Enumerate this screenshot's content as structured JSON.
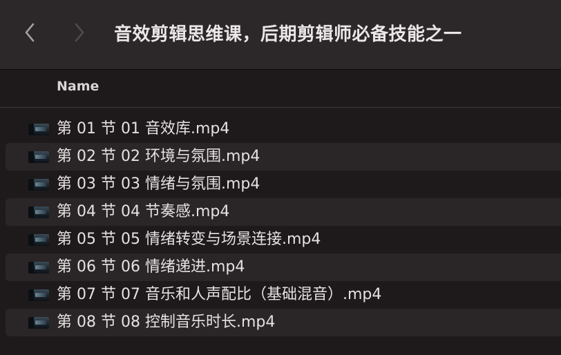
{
  "window": {
    "title": "音效剪辑思维课，后期剪辑师必备技能之一"
  },
  "toolbar": {
    "back_icon": "chevron-left-icon",
    "forward_icon": "chevron-right-icon"
  },
  "columns": {
    "name": "Name"
  },
  "files": [
    {
      "name": "第 01 节 01 音效库.mp4",
      "icon": "video-thumbnail-icon"
    },
    {
      "name": "第 02 节 02 环境与氛围.mp4",
      "icon": "video-thumbnail-icon"
    },
    {
      "name": "第 03 节 03 情绪与氛围.mp4",
      "icon": "video-thumbnail-icon"
    },
    {
      "name": "第 04 节 04 节奏感.mp4",
      "icon": "video-thumbnail-icon"
    },
    {
      "name": "第 05 节 05 情绪转变与场景连接.mp4",
      "icon": "video-thumbnail-icon"
    },
    {
      "name": "第 06 节 06 情绪递进.mp4",
      "icon": "video-thumbnail-icon"
    },
    {
      "name": "第 07 节 07 音乐和人声配比（基础混音）.mp4",
      "icon": "video-thumbnail-icon"
    },
    {
      "name": "第 08 节 08 控制音乐时长.mp4",
      "icon": "video-thumbnail-icon"
    }
  ],
  "colors": {
    "background": "#1e1a1b",
    "toolbar": "#2c2728",
    "row_alt": "#2a2526",
    "text": "#e6e2e3"
  }
}
